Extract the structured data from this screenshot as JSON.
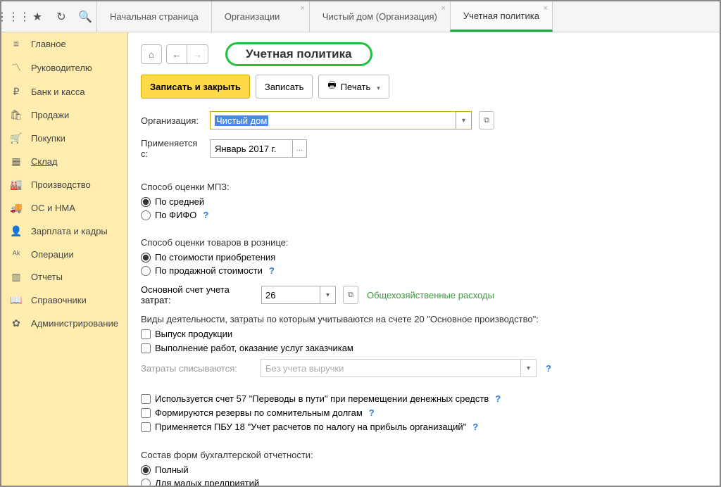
{
  "tabs": [
    {
      "label": "Начальная страница"
    },
    {
      "label": "Организации"
    },
    {
      "label": "Чистый дом (Организация)"
    },
    {
      "label": "Учетная политика"
    }
  ],
  "sidebar": [
    {
      "icon": "≡",
      "label": "Главное"
    },
    {
      "icon": "〽",
      "label": "Руководителю"
    },
    {
      "icon": "₽",
      "label": "Банк и касса"
    },
    {
      "icon": "🛍",
      "label": "Продажи"
    },
    {
      "icon": "🛒",
      "label": "Покупки"
    },
    {
      "icon": "▦",
      "label": "Склад"
    },
    {
      "icon": "🏭",
      "label": "Производство"
    },
    {
      "icon": "🚚",
      "label": "ОС и НМА"
    },
    {
      "icon": "👤",
      "label": "Зарплата и кадры"
    },
    {
      "icon": "ᴬᵏ",
      "label": "Операции"
    },
    {
      "icon": "▥",
      "label": "Отчеты"
    },
    {
      "icon": "📖",
      "label": "Справочники"
    },
    {
      "icon": "✿",
      "label": "Администрирование"
    }
  ],
  "page": {
    "title": "Учетная политика",
    "actions": {
      "save_close": "Записать и закрыть",
      "save": "Записать",
      "print": "Печать"
    },
    "org_label": "Организация:",
    "org_value": "Чистый дом",
    "applied_label": "Применяется с:",
    "applied_value": "Январь 2017 г.",
    "mpz_label": "Способ оценки МПЗ:",
    "mpz_opt1": "По средней",
    "mpz_opt2": "По ФИФО",
    "retail_label": "Способ оценки товаров в рознице:",
    "retail_opt1": "По стоимости приобретения",
    "retail_opt2": "По продажной стоимости",
    "acct_label": "Основной счет учета затрат:",
    "acct_value": "26",
    "acct_note": "Общехозяйственные расходы",
    "activities_label": "Виды деятельности, затраты по которым учитываются на счете 20 \"Основное производство\":",
    "act_chk1": "Выпуск продукции",
    "act_chk2": "Выполнение работ, оказание услуг заказчикам",
    "writeoff_label": "Затраты списываются:",
    "writeoff_value": "Без учета выручки",
    "chk57": "Используется счет 57 \"Переводы в пути\" при перемещении денежных средств",
    "chk_reserve": "Формируются резервы по сомнительным долгам",
    "chk_pbu18": "Применяется ПБУ 18 \"Учет расчетов по налогу на прибыль организаций\"",
    "reports_label": "Состав форм бухгалтерской отчетности:",
    "rep_opt1": "Полный",
    "rep_opt2": "Для малых предприятий"
  }
}
